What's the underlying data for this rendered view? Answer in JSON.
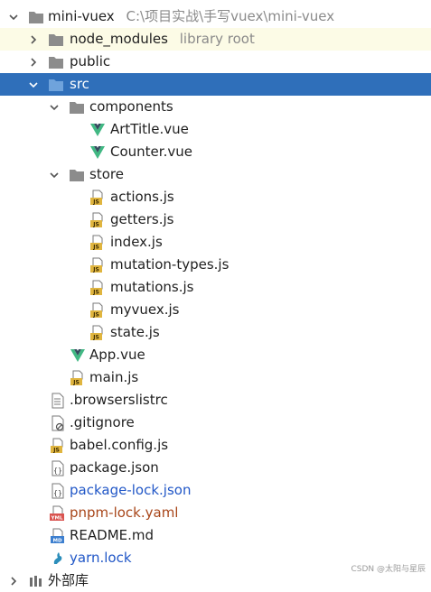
{
  "project_tree": {
    "root": {
      "label": "mini-vuex",
      "path": "C:\\项目实战\\手写vuex\\mini-vuex"
    },
    "node_modules": {
      "label": "node_modules",
      "hint": "library root"
    },
    "public": {
      "label": "public"
    },
    "src": {
      "label": "src"
    },
    "components": {
      "label": "components"
    },
    "artitle": {
      "label": "ArtTitle.vue"
    },
    "counter": {
      "label": "Counter.vue"
    },
    "store": {
      "label": "store"
    },
    "actions": {
      "label": "actions.js"
    },
    "getters": {
      "label": "getters.js"
    },
    "index": {
      "label": "index.js"
    },
    "mutation_types": {
      "label": "mutation-types.js"
    },
    "mutations": {
      "label": "mutations.js"
    },
    "myvuex": {
      "label": "myvuex.js"
    },
    "state": {
      "label": "state.js"
    },
    "app": {
      "label": "App.vue"
    },
    "main": {
      "label": "main.js"
    },
    "browserslistrc": {
      "label": ".browserslistrc"
    },
    "gitignore": {
      "label": ".gitignore"
    },
    "babel": {
      "label": "babel.config.js"
    },
    "package": {
      "label": "package.json"
    },
    "package_lock": {
      "label": "package-lock.json"
    },
    "pnpm_lock": {
      "label": "pnpm-lock.yaml"
    },
    "readme": {
      "label": "README.md"
    },
    "yarn_lock": {
      "label": "yarn.lock"
    },
    "external": {
      "label": "外部库"
    }
  },
  "watermark": "CSDN @太阳与星辰",
  "colors": {
    "selected_row": "#2f6fba",
    "highlight_row": "#fcfbe6",
    "folder": "#8c8c8c",
    "vue_green": "#41b883",
    "vue_dark": "#35495e",
    "js_badge": "#e0b53f",
    "modified_blue": "#2157c7",
    "new_brown": "#a8461a"
  }
}
